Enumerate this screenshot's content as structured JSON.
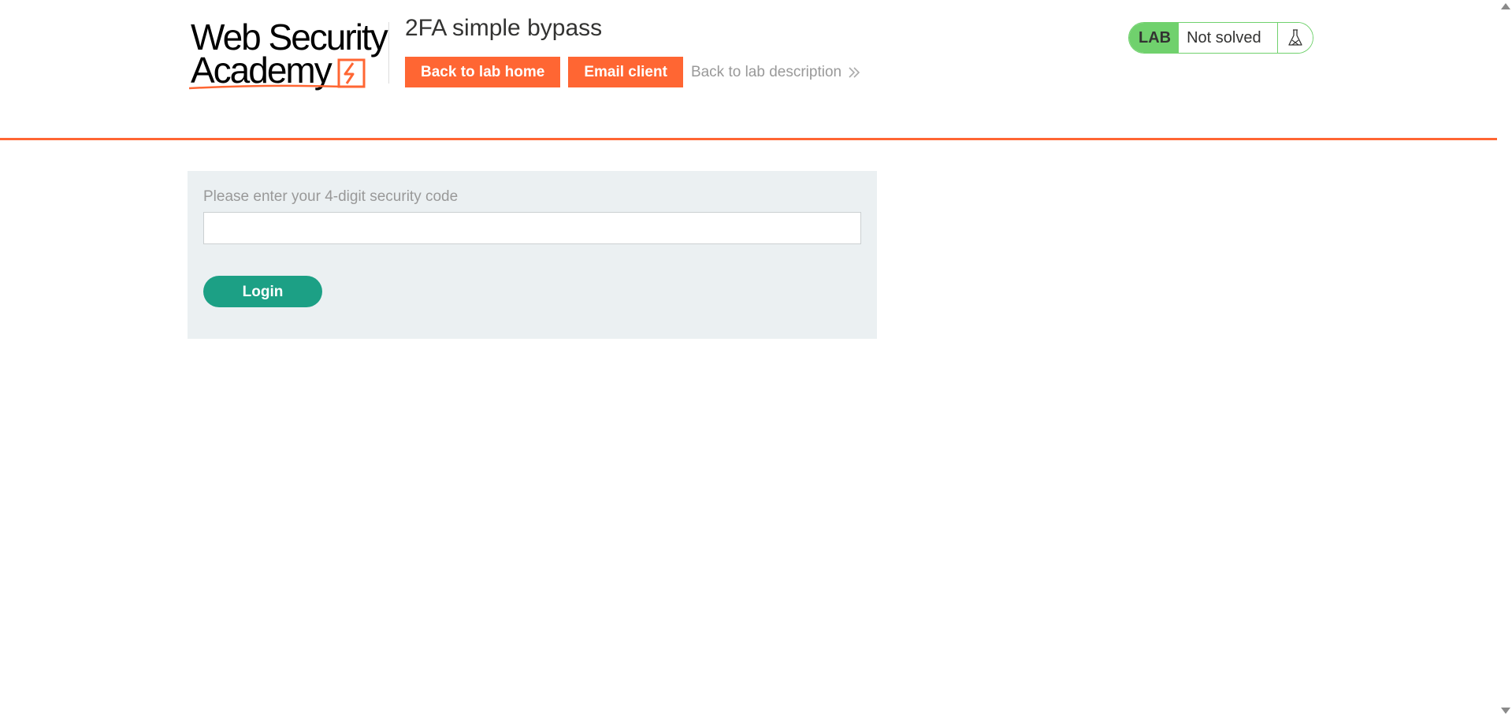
{
  "header": {
    "logo": {
      "line1": "Web Security",
      "line2": "Academy"
    },
    "lab_title": "2FA simple bypass",
    "buttons": {
      "back_to_lab_home": "Back to lab home",
      "email_client": "Email client"
    },
    "back_to_description": "Back to lab description",
    "lab_status": {
      "badge": "LAB",
      "state": "Not solved",
      "icon": "flask-icon"
    }
  },
  "form": {
    "code_label": "Please enter your 4-digit security code",
    "code_value": "",
    "login_label": "Login"
  },
  "colors": {
    "brand_orange": "#ff6633",
    "lab_green": "#70d16d",
    "login_green": "#1ca085",
    "panel_bg": "#ebf0f2"
  }
}
